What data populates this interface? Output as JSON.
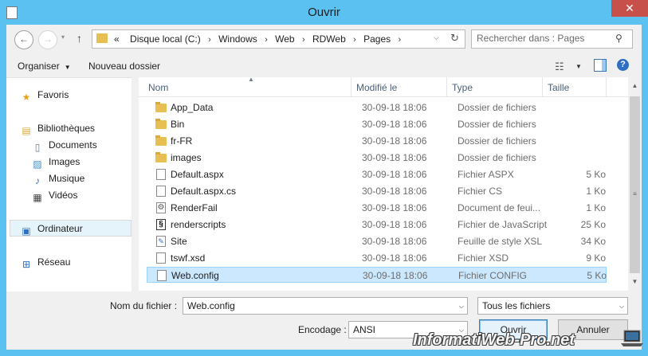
{
  "window": {
    "title": "Ouvrir",
    "close_glyph": "✕",
    "app_icon": "document-icon"
  },
  "nav_buttons": {
    "back_glyph": "←",
    "forward_glyph": "→",
    "history_glyph": "▾",
    "up_glyph": "↑"
  },
  "address": {
    "prefix": "«",
    "crumbs": [
      "Disque local (C:)",
      "Windows",
      "Web",
      "RDWeb",
      "Pages"
    ],
    "separator": "›",
    "dropdown_glyph": "⌵",
    "refresh_glyph": "↻"
  },
  "search": {
    "placeholder": "Rechercher dans : Pages",
    "icon_glyph": "⚲"
  },
  "toolbar": {
    "organize_label": "Organiser",
    "organize_caret": "▼",
    "new_folder_label": "Nouveau dossier",
    "view_glyph": "☷",
    "view_caret": "▼",
    "help_glyph": "?"
  },
  "sidebar": {
    "favorites": {
      "label": "Favoris",
      "icon": "★"
    },
    "libraries": {
      "label": "Bibliothèques",
      "icon": "▤"
    },
    "documents": {
      "label": "Documents",
      "icon": "▯"
    },
    "images": {
      "label": "Images",
      "icon": "▨"
    },
    "music": {
      "label": "Musique",
      "icon": "♪"
    },
    "videos": {
      "label": "Vidéos",
      "icon": "▦"
    },
    "computer": {
      "label": "Ordinateur",
      "icon": "▣"
    },
    "network": {
      "label": "Réseau",
      "icon": "⊞"
    }
  },
  "columns": {
    "name": "Nom",
    "modified": "Modifié le",
    "type": "Type",
    "size": "Taille",
    "sort_glyph": "▲"
  },
  "files": [
    {
      "name": "App_Data",
      "date": "30-09-18 18:06",
      "type": "Dossier de fichiers",
      "size": "",
      "icon": "folder"
    },
    {
      "name": "Bin",
      "date": "30-09-18 18:06",
      "type": "Dossier de fichiers",
      "size": "",
      "icon": "folder"
    },
    {
      "name": "fr-FR",
      "date": "30-09-18 18:06",
      "type": "Dossier de fichiers",
      "size": "",
      "icon": "folder"
    },
    {
      "name": "images",
      "date": "30-09-18 18:06",
      "type": "Dossier de fichiers",
      "size": "",
      "icon": "folder"
    },
    {
      "name": "Default.aspx",
      "date": "30-09-18 18:06",
      "type": "Fichier ASPX",
      "size": "5 Ko",
      "icon": "doc"
    },
    {
      "name": "Default.aspx.cs",
      "date": "30-09-18 18:06",
      "type": "Fichier CS",
      "size": "1 Ko",
      "icon": "doc"
    },
    {
      "name": "RenderFail",
      "date": "30-09-18 18:06",
      "type": "Document de feui...",
      "size": "1 Ko",
      "icon": "gear"
    },
    {
      "name": "renderscripts",
      "date": "30-09-18 18:06",
      "type": "Fichier de JavaScript",
      "size": "25 Ko",
      "icon": "script"
    },
    {
      "name": "Site",
      "date": "30-09-18 18:06",
      "type": "Feuille de style XSL",
      "size": "34 Ko",
      "icon": "xsl"
    },
    {
      "name": "tswf.xsd",
      "date": "30-09-18 18:06",
      "type": "Fichier XSD",
      "size": "9 Ko",
      "icon": "doc"
    },
    {
      "name": "Web.config",
      "date": "30-09-18 18:06",
      "type": "Fichier CONFIG",
      "size": "5 Ko",
      "icon": "doc",
      "selected": true
    }
  ],
  "file_icon_glyphs": {
    "gear": "⚙",
    "script": "§",
    "xsl": "✎"
  },
  "scrollbar": {
    "up_glyph": "▲",
    "down_glyph": "▼",
    "grip_glyph": "≡"
  },
  "bottom": {
    "filename_label": "Nom du fichier :",
    "filename_value": "Web.config",
    "filetype_value": "Tous les fichiers",
    "encoding_label": "Encodage :",
    "encoding_value": "ANSI",
    "dropdown_glyph": "⌵",
    "open_label": "Ouvrir",
    "cancel_label": "Annuler"
  },
  "watermark": {
    "text": "InformatiWeb-Pro.net"
  },
  "colors": {
    "title_bar": "#5bc1f0",
    "close_button": "#c7504a",
    "selection": "#cce8ff",
    "folder": "#e8bf52"
  }
}
